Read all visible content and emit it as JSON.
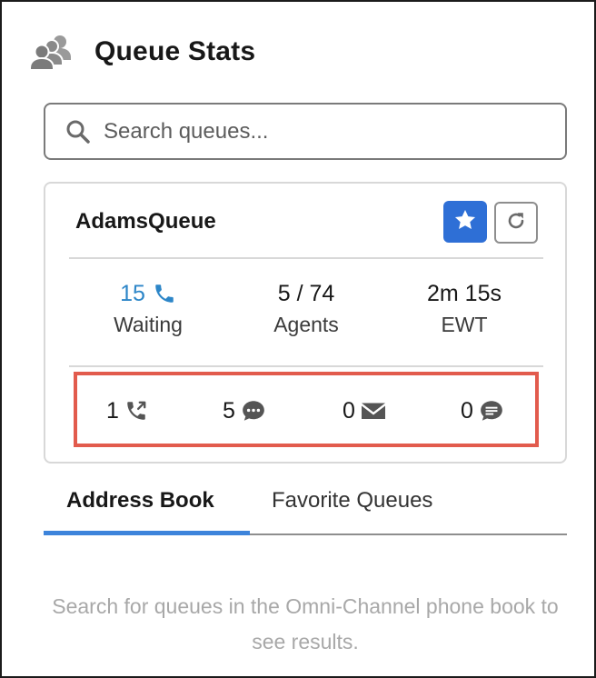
{
  "header": {
    "title": "Queue Stats",
    "icon": "users-group-icon"
  },
  "search": {
    "placeholder": "Search queues...",
    "value": ""
  },
  "queue_card": {
    "name": "AdamsQueue",
    "favorite_icon": "star-icon",
    "refresh_icon": "refresh-icon",
    "stats": [
      {
        "value": "15",
        "label": "Waiting",
        "icon": "phone-icon"
      },
      {
        "value": "5 / 74",
        "label": "Agents"
      },
      {
        "value": "2m 15s",
        "label": "EWT"
      }
    ],
    "channels": [
      {
        "value": "1",
        "icon": "phone-transfer-icon"
      },
      {
        "value": "5",
        "icon": "chat-bubble-icon"
      },
      {
        "value": "0",
        "icon": "email-icon"
      },
      {
        "value": "0",
        "icon": "message-icon"
      }
    ]
  },
  "tabs": [
    {
      "label": "Address Book",
      "active": true
    },
    {
      "label": "Favorite Queues",
      "active": false
    }
  ],
  "empty_message": "Search for queues in the Omni-Channel phone book to see results.",
  "colors": {
    "accent_blue": "#2e6fd6",
    "waiting_blue": "#2d86c8",
    "highlight_red": "#e25b4d",
    "tab_underline": "#3d84db"
  }
}
